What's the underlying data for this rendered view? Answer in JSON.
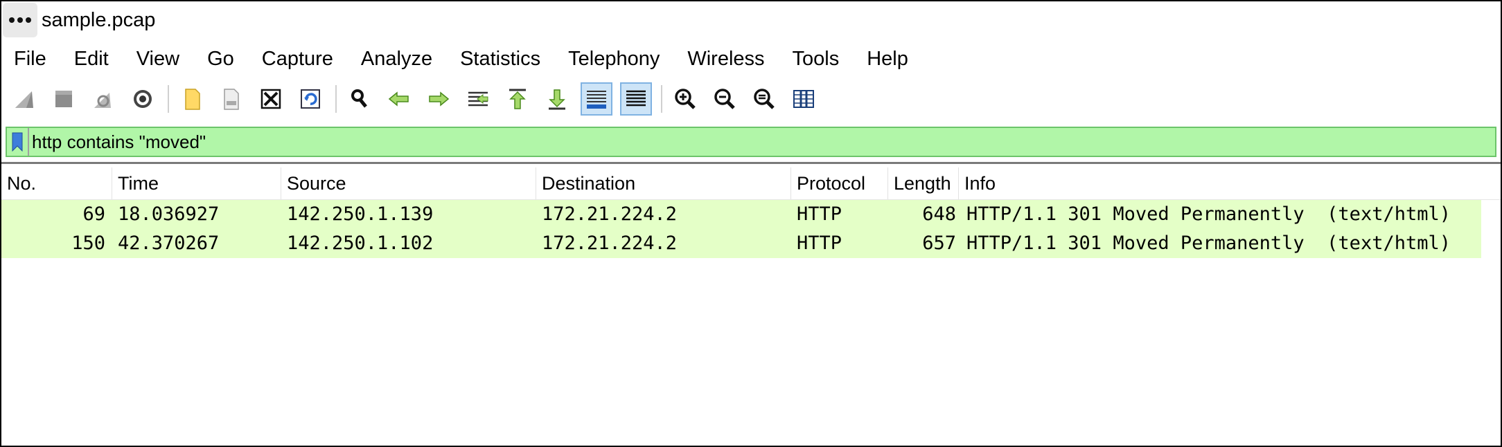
{
  "window": {
    "title": "sample.pcap"
  },
  "menu": [
    "File",
    "Edit",
    "View",
    "Go",
    "Capture",
    "Analyze",
    "Statistics",
    "Telephony",
    "Wireless",
    "Tools",
    "Help"
  ],
  "toolbar": {
    "buttons": [
      {
        "icon": "shark-fin-start-icon"
      },
      {
        "icon": "stop-capture-icon"
      },
      {
        "icon": "restart-capture-icon"
      },
      {
        "icon": "capture-options-icon"
      },
      {
        "icon": "open-file-icon"
      },
      {
        "icon": "save-file-icon"
      },
      {
        "icon": "close-file-icon"
      },
      {
        "icon": "reload-file-icon"
      },
      {
        "icon": "find-packet-icon"
      },
      {
        "icon": "go-back-icon"
      },
      {
        "icon": "go-forward-icon"
      },
      {
        "icon": "go-to-packet-icon"
      },
      {
        "icon": "go-first-packet-icon"
      },
      {
        "icon": "go-last-packet-icon"
      },
      {
        "icon": "autoscroll-icon"
      },
      {
        "icon": "colorize-icon"
      },
      {
        "icon": "zoom-in-icon"
      },
      {
        "icon": "zoom-out-icon"
      },
      {
        "icon": "zoom-normal-icon"
      },
      {
        "icon": "resize-columns-icon"
      }
    ]
  },
  "filter": {
    "value": "http contains \"moved\"",
    "background": "#b1f6a8"
  },
  "columns": [
    "No.",
    "Time",
    "Source",
    "Destination",
    "Protocol",
    "Length",
    "Info"
  ],
  "packets": [
    {
      "no": "69",
      "time": "18.036927",
      "source": "142.250.1.139",
      "destination": "172.21.224.2",
      "protocol": "HTTP",
      "length": "648",
      "info": "HTTP/1.1 301 Moved Permanently  (text/html)"
    },
    {
      "no": "150",
      "time": "42.370267",
      "source": "142.250.1.102",
      "destination": "172.21.224.2",
      "protocol": "HTTP",
      "length": "657",
      "info": "HTTP/1.1 301 Moved Permanently  (text/html)"
    }
  ],
  "colors": {
    "row_highlight": "#e4ffc7",
    "filter_ok": "#b1f6a8"
  }
}
